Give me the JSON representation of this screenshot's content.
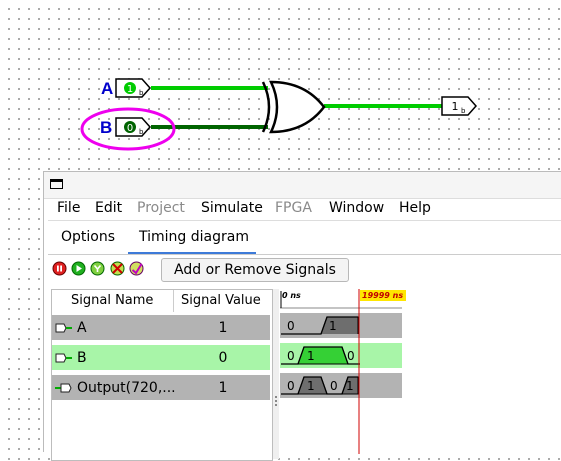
{
  "circuit": {
    "pins": [
      {
        "label": "A",
        "value": "1",
        "bits": "b"
      },
      {
        "label": "B",
        "value": "0",
        "bits": "b"
      }
    ],
    "output": {
      "value": "1",
      "bits": "b"
    },
    "selection_color": "#ee00ee",
    "wire_high_color": "#00cc00",
    "wire_low_color": "#006400"
  },
  "window": {
    "menu": [
      {
        "label": "File",
        "enabled": true
      },
      {
        "label": "Edit",
        "enabled": true
      },
      {
        "label": "Project",
        "enabled": false
      },
      {
        "label": "Simulate",
        "enabled": true
      },
      {
        "label": "FPGA",
        "enabled": false
      },
      {
        "label": "Window",
        "enabled": true
      },
      {
        "label": "Help",
        "enabled": true
      }
    ],
    "tabs": [
      {
        "label": "Options",
        "active": false
      },
      {
        "label": "Timing diagram",
        "active": true
      }
    ],
    "controls": [
      "stop-icon",
      "play-icon",
      "step-icon",
      "clear-icon",
      "zoom-icon"
    ],
    "add_remove_label": "Add or Remove Signals"
  },
  "signals": {
    "header_name": "Signal Name",
    "header_value": "Signal Value",
    "rows": [
      {
        "name": "A",
        "value": "1",
        "kind": "input",
        "selected": false
      },
      {
        "name": "B",
        "value": "0",
        "kind": "input",
        "selected": true
      },
      {
        "name": "Output(720,...",
        "value": "1",
        "kind": "output",
        "selected": false
      }
    ]
  },
  "timeline": {
    "start_label": "0 ns",
    "cursor_label": "19999 ns",
    "waves": {
      "A": [
        "0",
        "1"
      ],
      "B": [
        "0",
        "1",
        "0"
      ],
      "Output": [
        "0",
        "1",
        "0",
        "1"
      ]
    }
  }
}
